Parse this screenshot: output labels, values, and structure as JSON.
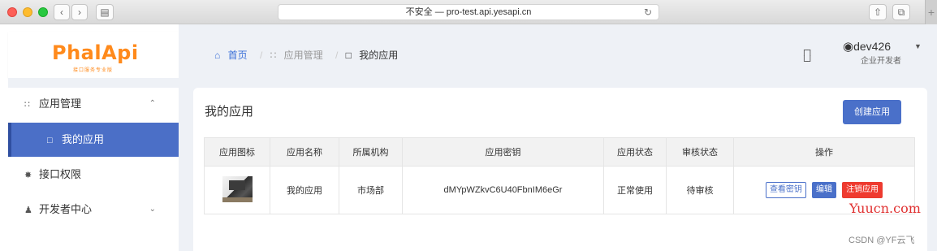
{
  "browser": {
    "url_text": "不安全 — pro-test.api.yesapi.cn",
    "reload_icon": "reload-icon",
    "plus": "+"
  },
  "logo": {
    "text": "PhalApi",
    "subtitle": "接口服务专业版"
  },
  "sidebar": {
    "items": [
      {
        "label": "应用管理",
        "icon": "grid-icon"
      },
      {
        "label": "我的应用",
        "icon": "window-icon",
        "active": true
      },
      {
        "label": "接口权限",
        "icon": "gear-icon"
      },
      {
        "label": "开发者中心",
        "icon": "user-icon"
      }
    ]
  },
  "breadcrumb": {
    "home": "首页",
    "section": "应用管理",
    "current": "我的应用"
  },
  "user": {
    "name": "dev426",
    "role": "企业开发者"
  },
  "page": {
    "title": "我的应用",
    "create_button": "创建应用"
  },
  "table": {
    "headers": [
      "应用图标",
      "应用名称",
      "所属机构",
      "应用密钥",
      "应用状态",
      "审核状态",
      "操作"
    ],
    "rows": [
      {
        "name": "我的应用",
        "org": "市场部",
        "key": "dMYpWZkvC6U40FbnIM6eGr",
        "status": "正常使用",
        "review": "待审核",
        "actions": [
          "查看密钥",
          "编辑",
          "注销应用"
        ]
      }
    ]
  },
  "watermarks": {
    "site": "Yuucn.com",
    "csdn": "CSDN @YF云飞"
  },
  "colors": {
    "accent": "#4a70c9",
    "danger": "#ef3a2f",
    "logo": "#ff8a1c"
  }
}
